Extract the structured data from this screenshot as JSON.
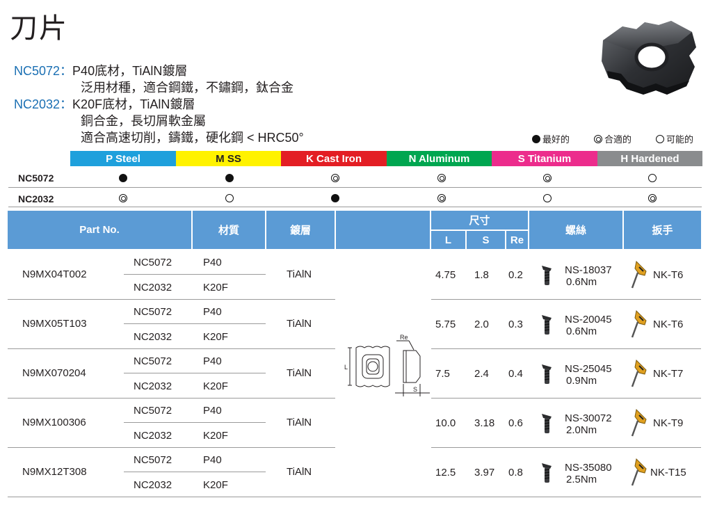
{
  "title": "刀片",
  "grades": [
    {
      "code": "NC5072",
      "sep": "：",
      "desc": "P40底材，TiAlN鍍層",
      "lines": [
        "泛用材種，適合鋼鐵，不鏽鋼，鈦合金"
      ]
    },
    {
      "code": "NC2032",
      "sep": "：",
      "desc": "K20F底材，TiAlN鍍層",
      "lines": [
        "銅合金，長切屑軟金屬",
        "適合高速切削，鑄鐵，硬化鋼 < HRC50°"
      ]
    }
  ],
  "legend": {
    "best": "最好的",
    "suitable": "合適的",
    "possible": "可能的"
  },
  "materials": [
    {
      "label": "P Steel",
      "color": "#1ea0dc"
    },
    {
      "label": "M SS",
      "color": "#fff200"
    },
    {
      "label": "K Cast Iron",
      "color": "#e31e24"
    },
    {
      "label": "N Aluminum",
      "color": "#00a650"
    },
    {
      "label": "S Titanium",
      "color": "#ec2c8c"
    },
    {
      "label": "H Hardened",
      "color": "#8a8c8e"
    }
  ],
  "suitability": [
    {
      "grade": "NC5072",
      "marks": [
        "full",
        "full",
        "ring",
        "ring",
        "ring",
        "open"
      ]
    },
    {
      "grade": "NC2032",
      "marks": [
        "ring",
        "open",
        "full",
        "ring",
        "open",
        "ring"
      ]
    }
  ],
  "table_header": {
    "part_no": "Part No.",
    "material": "材質",
    "coating": "鍍層",
    "dimensions": "尺寸",
    "L": "L",
    "S": "S",
    "Re": "Re",
    "screw": "螺絲",
    "wrench": "扳手"
  },
  "diagram_labels": {
    "L": "L",
    "S": "S",
    "Re": "Re"
  },
  "parts": [
    {
      "part_no": "N9MX04T002",
      "grades": [
        {
          "name": "NC5072",
          "substrate": "P40"
        },
        {
          "name": "NC2032",
          "substrate": "K20F"
        }
      ],
      "coating": "TiAlN",
      "L": "4.75",
      "S": "1.8",
      "Re": "0.2",
      "screw": "NS-18037",
      "torque": "0.6Nm",
      "wrench": "NK-T6"
    },
    {
      "part_no": "N9MX05T103",
      "grades": [
        {
          "name": "NC5072",
          "substrate": "P40"
        },
        {
          "name": "NC2032",
          "substrate": "K20F"
        }
      ],
      "coating": "TiAlN",
      "L": "5.75",
      "S": "2.0",
      "Re": "0.3",
      "screw": "NS-20045",
      "torque": "0.6Nm",
      "wrench": "NK-T6"
    },
    {
      "part_no": "N9MX070204",
      "grades": [
        {
          "name": "NC5072",
          "substrate": "P40"
        },
        {
          "name": "NC2032",
          "substrate": "K20F"
        }
      ],
      "coating": "TiAlN",
      "L": "7.5",
      "S": "2.4",
      "Re": "0.4",
      "screw": "NS-25045",
      "torque": "0.9Nm",
      "wrench": "NK-T7"
    },
    {
      "part_no": "N9MX100306",
      "grades": [
        {
          "name": "NC5072",
          "substrate": "P40"
        },
        {
          "name": "NC2032",
          "substrate": "K20F"
        }
      ],
      "coating": "TiAlN",
      "L": "10.0",
      "S": "3.18",
      "Re": "0.6",
      "screw": "NS-30072",
      "torque": "2.0Nm",
      "wrench": "NK-T9"
    },
    {
      "part_no": "N9MX12T308",
      "grades": [
        {
          "name": "NC5072",
          "substrate": "P40"
        },
        {
          "name": "NC2032",
          "substrate": "K20F"
        }
      ],
      "coating": "TiAlN",
      "L": "12.5",
      "S": "3.97",
      "Re": "0.8",
      "screw": "NS-35080",
      "torque": "2.5Nm",
      "wrench": "NK-T15"
    }
  ]
}
